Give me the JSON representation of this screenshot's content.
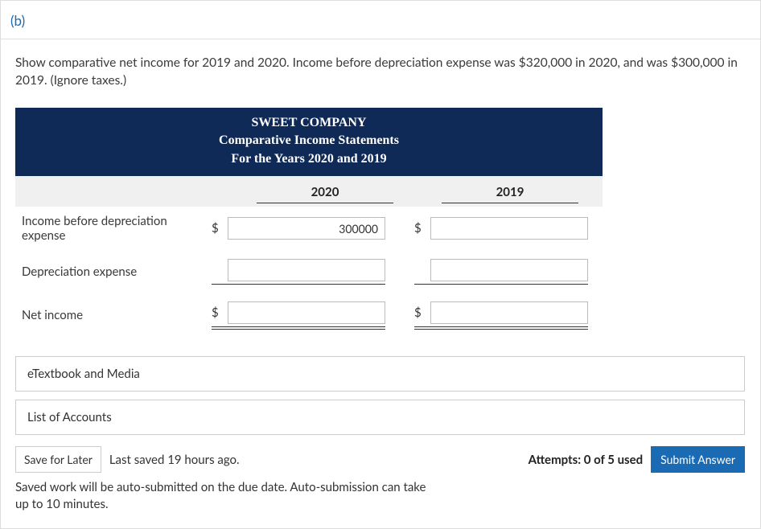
{
  "part_label": "(b)",
  "question": "Show comparative net income for 2019 and 2020. Income before depreciation expense was $320,000 in 2020, and was $300,000 in 2019. (Ignore taxes.)",
  "statement": {
    "title_line1": "SWEET COMPANY",
    "title_line2": "Comparative Income Statements",
    "title_line3": "For the Years 2020 and 2019",
    "col1": "2020",
    "col2": "2019",
    "rows": [
      {
        "label": "Income before depreciation expense",
        "currency": "$",
        "v1": "300000",
        "v2": "",
        "style": "plain"
      },
      {
        "label": "Depreciation expense",
        "currency": "",
        "v1": "",
        "v2": "",
        "style": "single"
      },
      {
        "label": "Net income",
        "currency": "$",
        "v1": "",
        "v2": "",
        "style": "double"
      }
    ]
  },
  "links": {
    "etextbook": "eTextbook and Media",
    "accounts": "List of Accounts"
  },
  "footer": {
    "save": "Save for Later",
    "last_saved": "Last saved 19 hours ago.",
    "attempts": "Attempts: 0 of 5 used",
    "submit": "Submit Answer",
    "autosave": "Saved work will be auto-submitted on the due date. Auto-submission can take up to 10 minutes."
  }
}
